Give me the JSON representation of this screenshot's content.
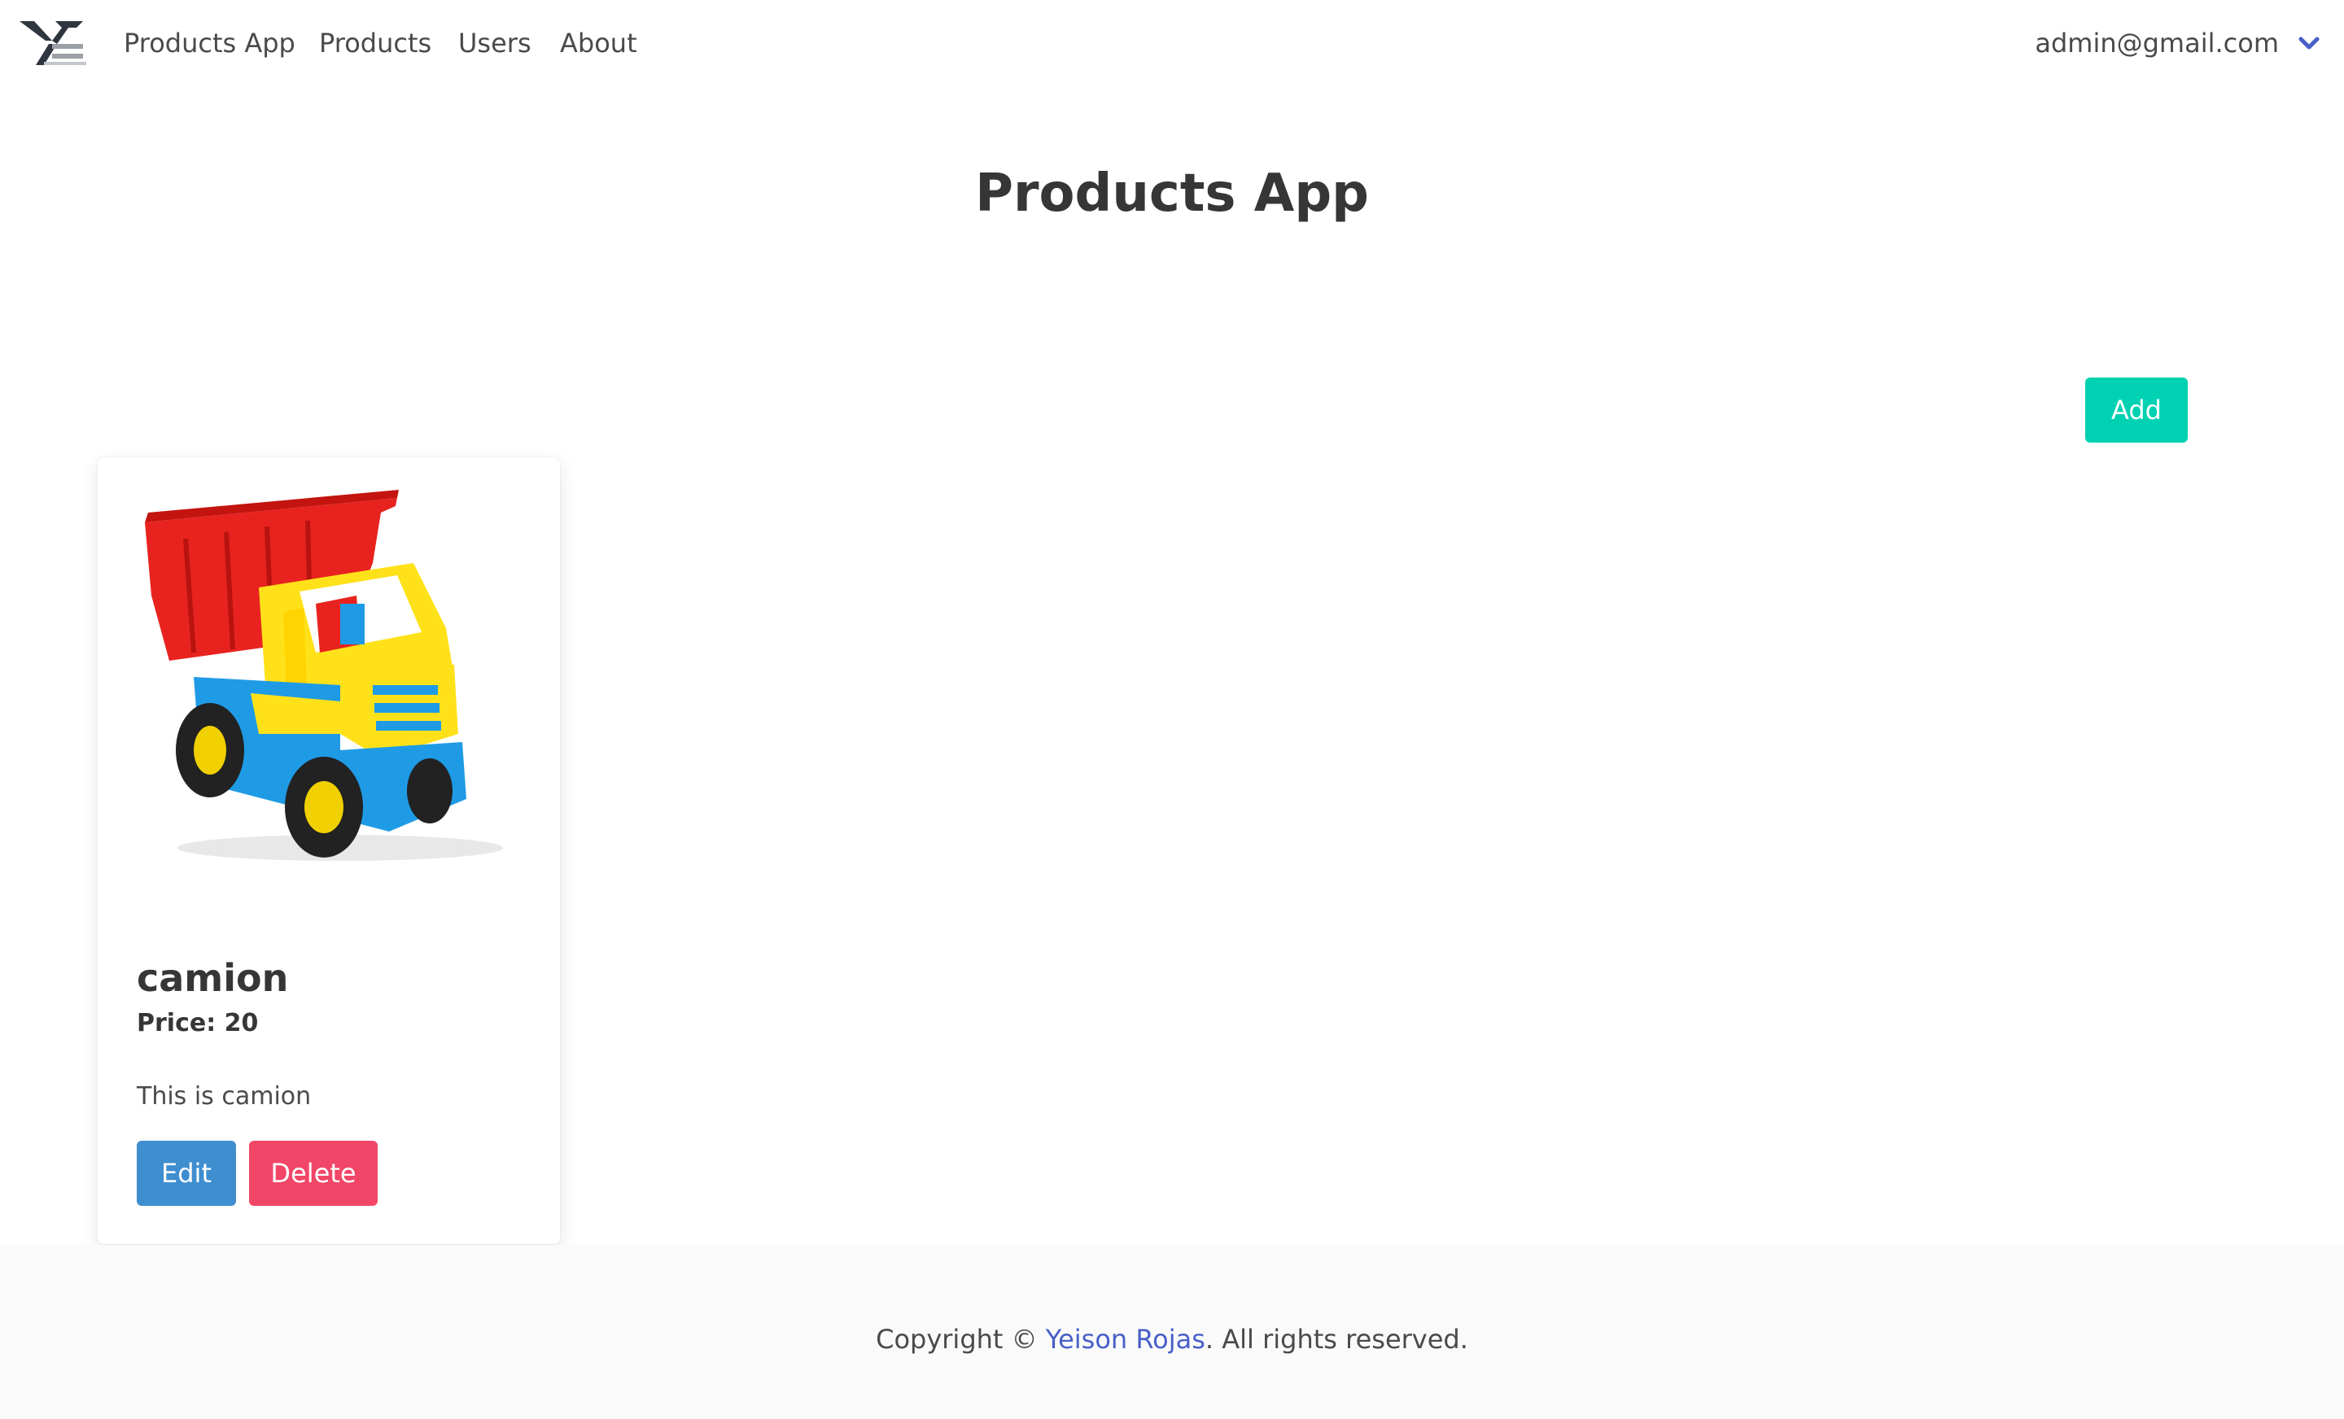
{
  "navbar": {
    "items": [
      {
        "label": "Products App"
      },
      {
        "label": "Products"
      },
      {
        "label": "Users"
      },
      {
        "label": "About"
      }
    ],
    "user_email": "admin@gmail.com"
  },
  "main": {
    "title": "Products App",
    "add_label": "Add"
  },
  "products": [
    {
      "name": "camion",
      "price_text": "Price: 20",
      "description": "This is camion",
      "edit_label": "Edit",
      "delete_label": "Delete"
    }
  ],
  "footer": {
    "prefix": "Copyright © ",
    "author": "Yeison Rojas",
    "suffix": ". All rights reserved."
  },
  "colors": {
    "primary": "#00d1b2",
    "info": "#3e8ed0",
    "danger": "#f14668",
    "link": "#485fc7"
  }
}
